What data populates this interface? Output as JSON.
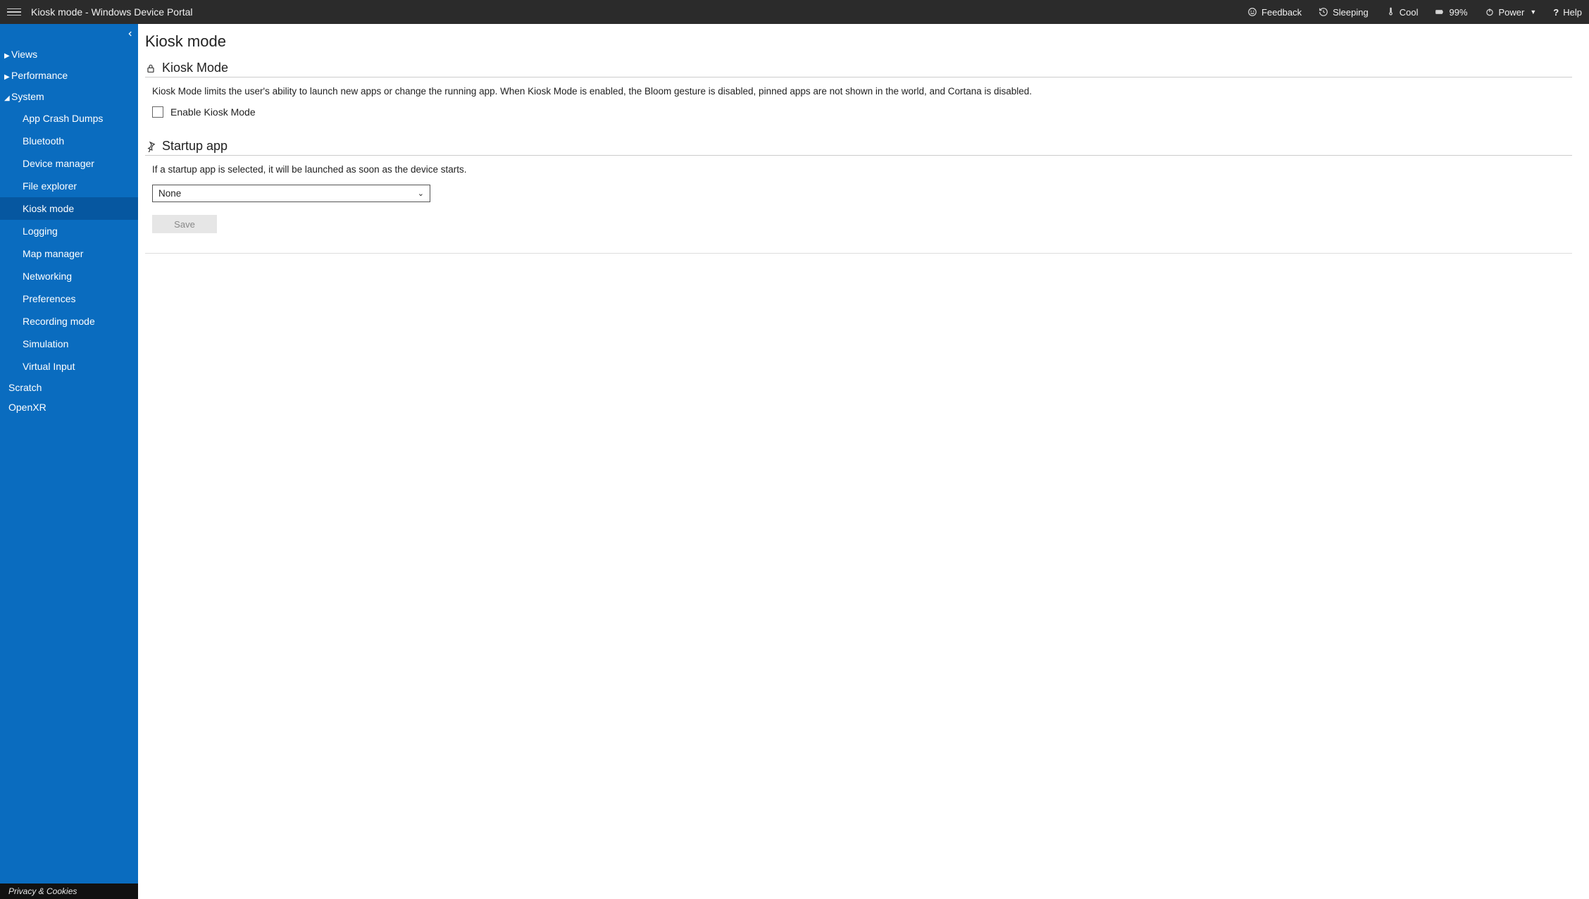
{
  "titlebar": {
    "title": "Kiosk mode - Windows Device Portal",
    "feedback": "Feedback",
    "sleeping": "Sleeping",
    "cool": "Cool",
    "battery": "99%",
    "power": "Power",
    "help": "Help"
  },
  "sidebar": {
    "groups": [
      {
        "label": "Views",
        "expanded": false
      },
      {
        "label": "Performance",
        "expanded": false
      },
      {
        "label": "System",
        "expanded": true,
        "items": [
          {
            "label": "App Crash Dumps",
            "selected": false
          },
          {
            "label": "Bluetooth",
            "selected": false
          },
          {
            "label": "Device manager",
            "selected": false
          },
          {
            "label": "File explorer",
            "selected": false
          },
          {
            "label": "Kiosk mode",
            "selected": true
          },
          {
            "label": "Logging",
            "selected": false
          },
          {
            "label": "Map manager",
            "selected": false
          },
          {
            "label": "Networking",
            "selected": false
          },
          {
            "label": "Preferences",
            "selected": false
          },
          {
            "label": "Recording mode",
            "selected": false
          },
          {
            "label": "Simulation",
            "selected": false
          },
          {
            "label": "Virtual Input",
            "selected": false
          }
        ]
      }
    ],
    "flat": [
      {
        "label": "Scratch"
      },
      {
        "label": "OpenXR"
      }
    ],
    "footer": "Privacy & Cookies"
  },
  "main": {
    "page_title": "Kiosk mode",
    "section1": {
      "title": "Kiosk Mode",
      "desc": "Kiosk Mode limits the user's ability to launch new apps or change the running app. When Kiosk Mode is enabled, the Bloom gesture is disabled, pinned apps are not shown in the world, and Cortana is disabled.",
      "checkbox_label": "Enable Kiosk Mode"
    },
    "section2": {
      "title": "Startup app",
      "desc": "If a startup app is selected, it will be launched as soon as the device starts.",
      "select_value": "None",
      "save_label": "Save"
    }
  }
}
